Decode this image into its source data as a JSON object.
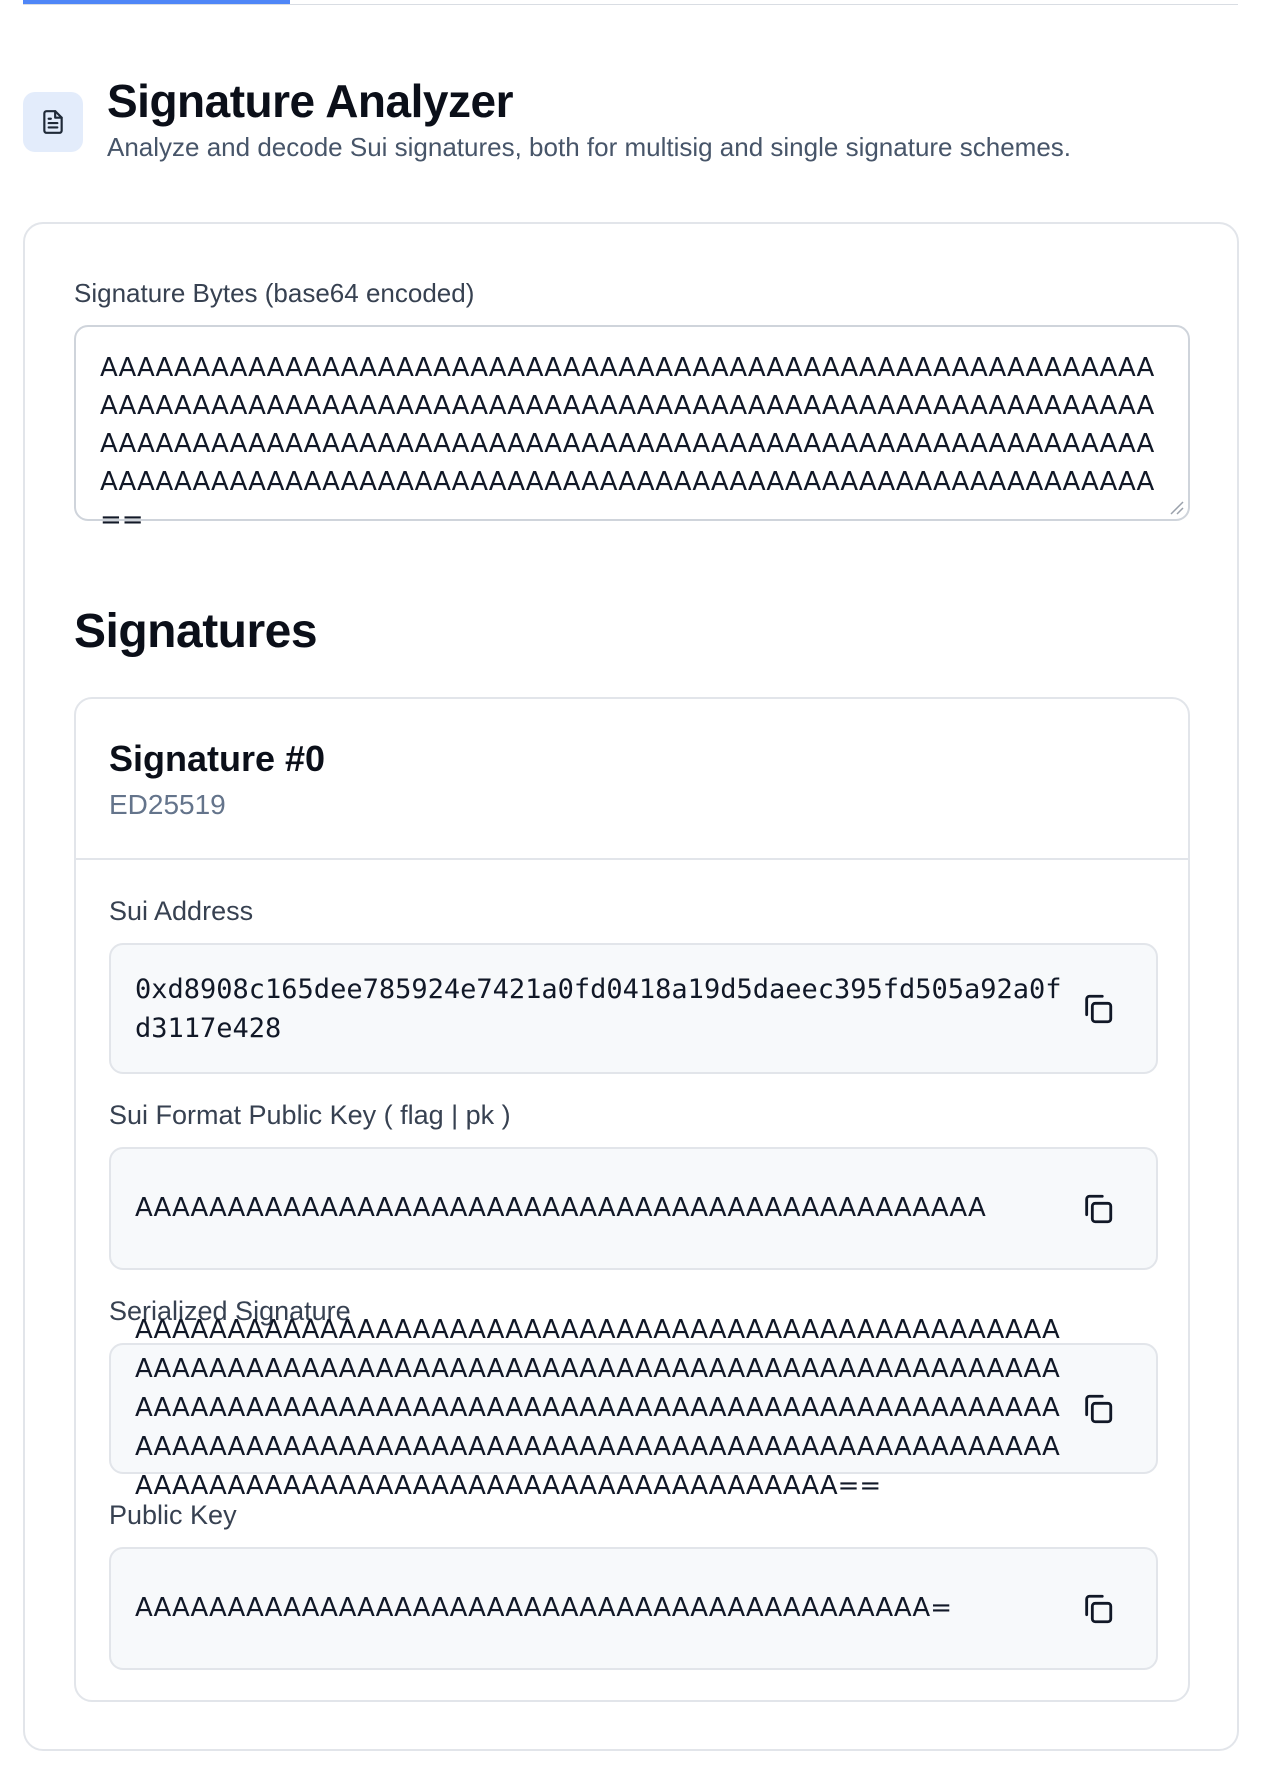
{
  "progress": {
    "fraction": 0.22
  },
  "header": {
    "icon": "document-icon",
    "title": "Signature Analyzer",
    "subtitle": "Analyze and decode Sui signatures, both for multisig and single signature schemes."
  },
  "input": {
    "label": "Signature Bytes (base64 encoded)",
    "value": "AAAAAAAAAAAAAAAAAAAAAAAAAAAAAAAAAAAAAAAAAAAAAAAAAAAAAAAAAAAAAAAAAAAAAAAAAAAAAAAAAAAAAAAAAAAAAAAAAAAAAAAAAAAAAAAAAAAAAAAAAAAAAAAAAAAAAAAAAAAAAAAAAAAAAAAAAAAAAAAAAAAAAAAAAAAAAAAAAAAAAAAAAAAAAAAAAAAAAAAAAAAAAAAAAAAAAAAAAAAAAAAAAAAA=="
  },
  "signatures": {
    "heading": "Signatures",
    "items": [
      {
        "title": "Signature #0",
        "scheme": "ED25519",
        "fields": {
          "address": {
            "label": "Sui Address",
            "value": "0xd8908c165dee785924e7421a0fd0418a19d5daeec395fd505a92a0fd3117e428"
          },
          "sui_public_key": {
            "label": "Sui Format Public Key ( flag | pk )",
            "value": "AAAAAAAAAAAAAAAAAAAAAAAAAAAAAAAAAAAAAAAAAAAAAA"
          },
          "serialized_signature": {
            "label": "Serialized Signature",
            "value": "AAAAAAAAAAAAAAAAAAAAAAAAAAAAAAAAAAAAAAAAAAAAAAAAAAAAAAAAAAAAAAAAAAAAAAAAAAAAAAAAAAAAAAAAAAAAAAAAAAAAAAAAAAAAAAAAAAAAAAAAAAAAAAAAAAAAAAAAAAAAAAAAAAAAAAAAAAAAAAAAAAAAAAAAAAAAAAAAAAAAAAAAAAAAAAAAAAAAAAAAAAAAAAAAAAAAAAAAAAAAAAAAAAAAAAAAAAAAAA=="
          },
          "public_key": {
            "label": "Public Key",
            "value": "AAAAAAAAAAAAAAAAAAAAAAAAAAAAAAAAAAAAAAAAAAA="
          }
        }
      }
    ]
  },
  "icons": {
    "copy": "copy-icon",
    "resize": "resize-handle-icon"
  },
  "colors": {
    "accent": "#4f86f7",
    "icon_bg": "#e3ecfb",
    "value_bg": "#f7f9fb",
    "border": "#e2e5ea"
  }
}
